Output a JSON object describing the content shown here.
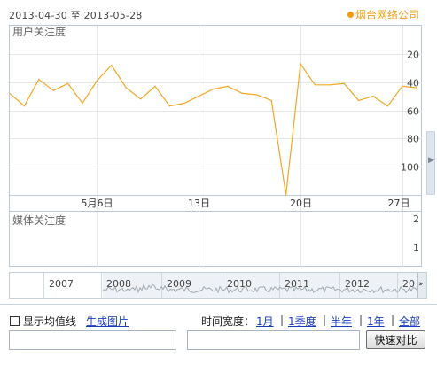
{
  "header": {
    "date_from": "2013-04-30",
    "date_sep": "至",
    "date_to": "2013-05-28",
    "brand_label": "烟台网络公司",
    "brand_color": "#f39c12"
  },
  "user_panel": {
    "label": "用户关注度",
    "y_ticks": [
      "100",
      "80",
      "60",
      "40",
      "20"
    ],
    "x_ticks": [
      "5月6日",
      "13日",
      "20日",
      "27日"
    ]
  },
  "media_panel": {
    "label": "媒体关注度",
    "y_ticks": [
      "2",
      "1"
    ]
  },
  "navigator": {
    "years": [
      "2007",
      "2008",
      "2009",
      "2010",
      "2011",
      "2012",
      "20"
    ]
  },
  "controls": {
    "moving_average_label": "显示均值线",
    "moving_average_checked": false,
    "generate_image_label": "生成图片",
    "time_width_label": "时间宽度：",
    "ranges": [
      "1月",
      "1季度",
      "半年",
      "1年",
      "全部"
    ],
    "range_separator": "|",
    "keyword_input_1": "",
    "keyword_input_2": "",
    "compare_button_label": "快速对比"
  },
  "chart_data": {
    "type": "line",
    "title": "",
    "xlabel": "",
    "ylabel": "用户关注度",
    "x": [
      "2013-04-30",
      "2013-05-01",
      "2013-05-02",
      "2013-05-03",
      "2013-05-04",
      "2013-05-05",
      "2013-05-06",
      "2013-05-07",
      "2013-05-08",
      "2013-05-09",
      "2013-05-10",
      "2013-05-11",
      "2013-05-12",
      "2013-05-13",
      "2013-05-14",
      "2013-05-15",
      "2013-05-16",
      "2013-05-17",
      "2013-05-18",
      "2013-05-19",
      "2013-05-20",
      "2013-05-21",
      "2013-05-22",
      "2013-05-23",
      "2013-05-24",
      "2013-05-25",
      "2013-05-26",
      "2013-05-27",
      "2013-05-28"
    ],
    "x_tick_labels": [
      "5月6日",
      "13日",
      "20日",
      "27日"
    ],
    "series": [
      {
        "color": "#f5a623",
        "values": [
          72,
          63,
          82,
          74,
          79,
          65,
          81,
          92,
          76,
          68,
          77,
          63,
          65,
          70,
          75,
          77,
          72,
          71,
          67,
          0,
          93,
          78,
          78,
          79,
          67,
          70,
          63,
          77,
          76
        ]
      }
    ],
    "ylim": [
      0,
      120
    ],
    "y_ticks": [
      20,
      40,
      60,
      80,
      100
    ],
    "grid": true,
    "legend": "none"
  }
}
